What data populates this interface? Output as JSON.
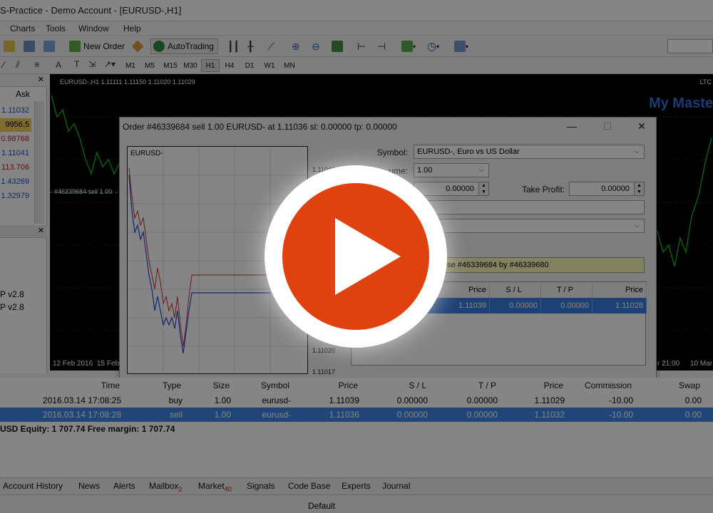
{
  "window": {
    "title": "S-Practice - Demo Account - [EURUSD-,H1]"
  },
  "menu": [
    "Charts",
    "Tools",
    "Window",
    "Help"
  ],
  "toolbar": {
    "new_order": "New Order",
    "autotrading": "AutoTrading"
  },
  "timeframes": [
    "M1",
    "M5",
    "M15",
    "M30",
    "H1",
    "H4",
    "D1",
    "W1",
    "MN"
  ],
  "timeframe_selected": "H1",
  "market_watch": {
    "ask_header": "Ask",
    "values": [
      "1.11032",
      "9956.5",
      "0.98768",
      "1.11041",
      "113.706",
      "1.43269",
      "1.32979"
    ],
    "colors": [
      "#1f4fd0",
      "#000000",
      "#c01818",
      "#1f4fd0",
      "#c01818",
      "#1f4fd0",
      "#1f4fd0"
    ]
  },
  "navigator": {
    "items": [
      "P v2.8",
      "P v2.8"
    ]
  },
  "chart": {
    "header": "EURUSD-,H1  1.11111 1.11150 1.11020 1.11029",
    "ltc": "LTC",
    "brand": "My Maste",
    "order_line_label": "#46339684 sell 1.00",
    "date_left": "12 Feb 2016",
    "date_left2": "15 Feb",
    "date_right1": "r 21:00",
    "date_right2": "10 Mar"
  },
  "dialog": {
    "title": "Order #46339684 sell 1.00 EURUSD- at 1.11036 sl: 0.00000 tp: 0.00000",
    "minichart_symbol": "EURUSD-",
    "minichart_prices": [
      "1.11042",
      "1.11020",
      "1.11017"
    ],
    "symbol_label": "Symbol:",
    "symbol_value": "EURUSD-, Euro vs US Dollar",
    "volume_label": "ume:",
    "volume_value": "1.00",
    "stoploss_value": "0.00000",
    "takeprofit_label": "Take Profit:",
    "takeprofit_value": "0.00000",
    "close_by_text": "ose #46339684 by #46339680",
    "orders_table": {
      "headers": [
        "Price",
        "S / L",
        "T / P",
        "Price"
      ],
      "row": [
        "1.11039",
        "0.00000",
        "0.00000",
        "1.11028"
      ]
    }
  },
  "terminal": {
    "headers": [
      "Time",
      "Type",
      "Size",
      "Symbol",
      "Price",
      "S / L",
      "T / P",
      "Price",
      "Commission",
      "Swap"
    ],
    "rows": [
      [
        "2016.03.14 17:08:25",
        "buy",
        "1.00",
        "eurusd-",
        "1.11039",
        "0.00000",
        "0.00000",
        "1.11029",
        "-10.00",
        "0.00"
      ],
      [
        "2016.03.14 17:08:28",
        "sell",
        "1.00",
        "eurusd-",
        "1.11036",
        "0.00000",
        "0.00000",
        "1.11032",
        "-10.00",
        "0.00"
      ]
    ],
    "equity_line": "USD  Equity: 1 707.74  Free margin: 1 707.74"
  },
  "bottom_tabs": [
    {
      "label": "Account History",
      "badge": ""
    },
    {
      "label": "News",
      "badge": ""
    },
    {
      "label": "Alerts",
      "badge": ""
    },
    {
      "label": "Mailbox",
      "badge": "2"
    },
    {
      "label": "Market",
      "badge": "40"
    },
    {
      "label": "Signals",
      "badge": ""
    },
    {
      "label": "Code Base",
      "badge": ""
    },
    {
      "label": "Experts",
      "badge": ""
    },
    {
      "label": "Journal",
      "badge": ""
    }
  ],
  "status": {
    "profile": "Default"
  },
  "overlay": {
    "play_color": "#e0420f",
    "icon": "play-icon"
  }
}
